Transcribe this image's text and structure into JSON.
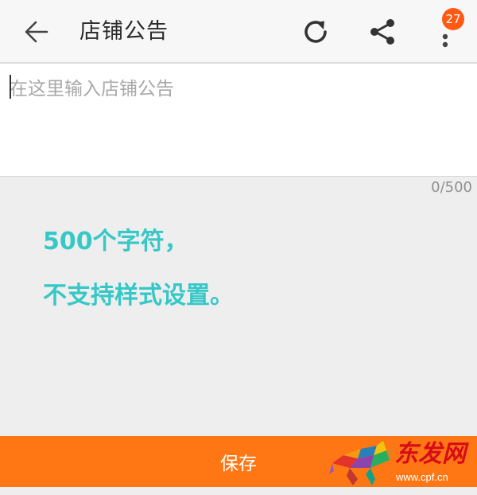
{
  "header": {
    "title": "店铺公告",
    "back_icon": "arrow-left-icon",
    "refresh_icon": "refresh-icon",
    "share_icon": "share-icon",
    "more_icon": "more-vertical-icon",
    "badge_count": "27",
    "badge_color": "#ff5a14"
  },
  "editor": {
    "placeholder": "在这里输入店铺公告",
    "value": "",
    "counter": "0/500"
  },
  "annotation": {
    "line1": "500个字符，",
    "line2": "不支持样式设置。",
    "color": "#36c7c7"
  },
  "footer": {
    "save_label": "保存",
    "save_color": "#ff7715"
  },
  "watermark": {
    "logo_text": "东发网",
    "url": "www.cpf.cn"
  }
}
